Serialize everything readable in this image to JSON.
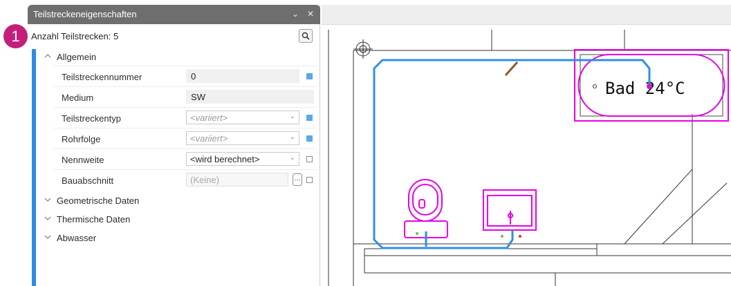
{
  "panel": {
    "title": "Teilstreckeneigenschaften",
    "minimize_glyph": "⌄",
    "close_glyph": "✕",
    "count_label": "Anzahl Teilstrecken: 5",
    "search_icon": "magnifier-icon"
  },
  "badge": {
    "number": "1",
    "color": "#c41e7a"
  },
  "groups": {
    "allgemein": "Allgemein",
    "geometrie": "Geometrische Daten",
    "thermisch": "Thermische Daten",
    "abwasser": "Abwasser"
  },
  "properties": [
    {
      "name": "Teilstreckennummer",
      "value": "0",
      "kind": "readonly",
      "flag": "filled"
    },
    {
      "name": "Medium",
      "value": "SW",
      "kind": "readonly",
      "flag": "none"
    },
    {
      "name": "Teilstreckentyp",
      "value": "<variiert>",
      "kind": "combo",
      "flag": "filled"
    },
    {
      "name": "Rohrfolge",
      "value": "<variiert>",
      "kind": "combo",
      "flag": "filled"
    },
    {
      "name": "Nennweite",
      "value": "<wird berechnet>",
      "kind": "combo",
      "flag": "empty"
    },
    {
      "name": "Bauabschnitt",
      "value": "(Keine)",
      "kind": "combo-disabled",
      "flag": "empty"
    }
  ],
  "drawing": {
    "room_label": "Bad 24°C",
    "pipe_color": "#2f8fe6",
    "fixture_color": "#e600e6",
    "accent_color": "#2d8be3"
  }
}
